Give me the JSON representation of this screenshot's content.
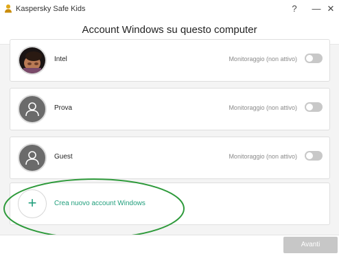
{
  "window": {
    "title": "Kaspersky Safe Kids",
    "help_glyph": "?",
    "minimize_glyph": "—",
    "close_glyph": "✕"
  },
  "page": {
    "heading": "Account Windows su questo computer"
  },
  "accounts": [
    {
      "name": "Intel",
      "status": "Monitoraggio (non attivo)",
      "avatar": "photo",
      "monitoring_enabled": false
    },
    {
      "name": "Prova",
      "status": "Monitoraggio (non attivo)",
      "avatar": "person-icon",
      "monitoring_enabled": false
    },
    {
      "name": "Guest",
      "status": "Monitoraggio (non attivo)",
      "avatar": "person-icon",
      "monitoring_enabled": false
    }
  ],
  "create_account": {
    "icon_glyph": "+",
    "label": "Crea nuovo account Windows"
  },
  "footer": {
    "next_label": "Avanti",
    "next_enabled": false
  },
  "colors": {
    "accent": "#1f9e7b",
    "highlight_ellipse": "#2e9a3b",
    "toggle_off": "#c8c8c8",
    "disabled_button": "#c7c7c7"
  }
}
